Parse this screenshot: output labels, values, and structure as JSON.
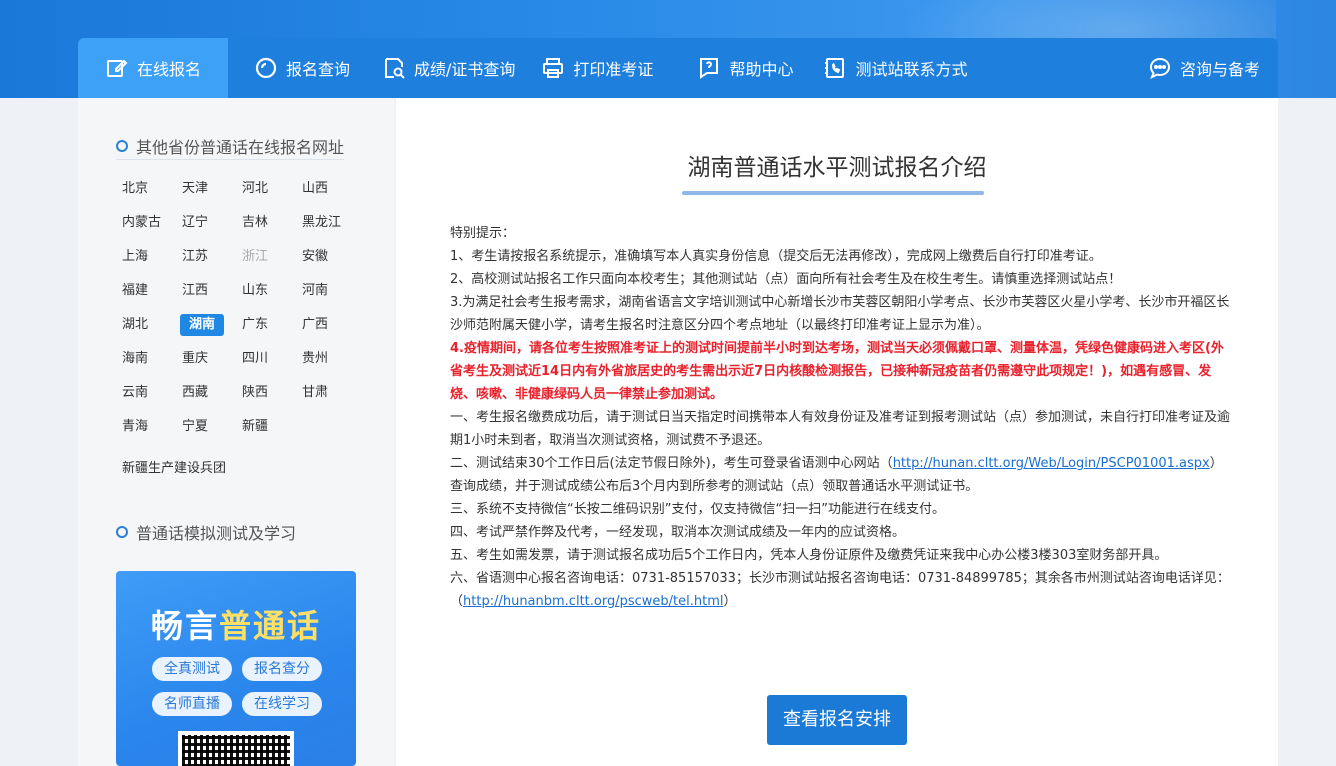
{
  "nav": {
    "items": [
      {
        "label": "在线报名",
        "icon": "edit-icon"
      },
      {
        "label": "报名查询",
        "icon": "search-icon"
      },
      {
        "label": "成绩/证书查询",
        "icon": "certificate-search-icon"
      },
      {
        "label": "打印准考证",
        "icon": "printer-icon"
      },
      {
        "label": "帮助中心",
        "icon": "help-icon"
      },
      {
        "label": "测试站联系方式",
        "icon": "phone-book-icon"
      }
    ],
    "consult": {
      "label": "咨询与备考",
      "icon": "chat-icon"
    }
  },
  "sidebar": {
    "provinces_title": "其他省份普通话在线报名网址",
    "provinces": [
      "北京",
      "天津",
      "河北",
      "山西",
      "内蒙古",
      "辽宁",
      "吉林",
      "黑龙江",
      "上海",
      "江苏",
      "浙江",
      "安徽",
      "福建",
      "江西",
      "山东",
      "河南",
      "湖北",
      "湖南",
      "广东",
      "广西",
      "海南",
      "重庆",
      "四川",
      "贵州",
      "云南",
      "西藏",
      "陕西",
      "甘肃",
      "青海",
      "宁夏",
      "新疆"
    ],
    "active_province": "湖南",
    "disabled_province": "浙江",
    "xinjiang_bt": "新疆生产建设兵团",
    "study_title": "普通话模拟测试及学习",
    "promo": {
      "title_a": "畅言",
      "title_b": "普通话",
      "pills": [
        "全真测试",
        "报名查分",
        "名师直播",
        "在线学习"
      ]
    }
  },
  "main": {
    "title": "湖南普通话水平测试报名介绍",
    "intro": "特别提示：",
    "p1": "1、考生请按报名系统提示，准确填写本人真实身份信息（提交后无法再修改），完成网上缴费后自行打印准考证。",
    "p2": "2、高校测试站报名工作只面向本校考生；其他测试站（点）面向所有社会考生及在校生考生。请慎重选择测试站点！",
    "p3": "3.为满足社会考生报考需求，湖南省语言文字培训测试中心新增长沙市芙蓉区朝阳小学考点、长沙市芙蓉区火星小学考、长沙市开福区长沙师范附属天健小学，请考生报名时注意区分四个考点地址（以最终打印准考证上显示为准）。",
    "p4": "4.疫情期间，请各位考生按照准考证上的测试时间提前半小时到达考场，测试当天必须佩戴口罩、测量体温，凭绿色健康码进入考区(外省考生及测试近14日内有外省旅居史的考生需出示近7日内核酸检测报告，已接种新冠疫苗者仍需遵守此项规定！)，如遇有感冒、发烧、咳嗽、非健康绿码人员一律禁止参加测试。",
    "n1": "一、考生报名缴费成功后，请于测试日当天指定时间携带本人有效身份证及准考证到报考测试站（点）参加测试，未自行打印准考证及逾期1小时未到者，取消当次测试资格，测试费不予退还。",
    "n2_a": "二、测试结束30个工作日后(法定节假日除外)，考生可登录省语测中心网站（",
    "n2_link": "http://hunan.cltt.org/Web/Login/PSCP01001.aspx",
    "n2_b": "）查询成绩，并于测试成绩公布后3个月内到所参考的测试站（点）领取普通话水平测试证书。",
    "n3": "三、系统不支持微信“长按二维码识别”支付，仅支持微信“扫一扫”功能进行在线支付。",
    "n4": "四、考试严禁作弊及代考，一经发现，取消本次测试成绩及一年内的应试资格。",
    "n5": "五、考生如需发票，请于测试报名成功后5个工作日内，凭本人身份证原件及缴费凭证来我中心办公楼3楼303室财务部开具。",
    "n6_a": "六、省语测中心报名咨询电话：0731-85157033；长沙市测试站报名咨询电话：0731-84899785；其余各市州测试站咨询电话详见：（",
    "n6_link": "http://hunanbm.cltt.org/pscweb/tel.html",
    "n6_b": "）",
    "cta": "查看报名安排"
  }
}
